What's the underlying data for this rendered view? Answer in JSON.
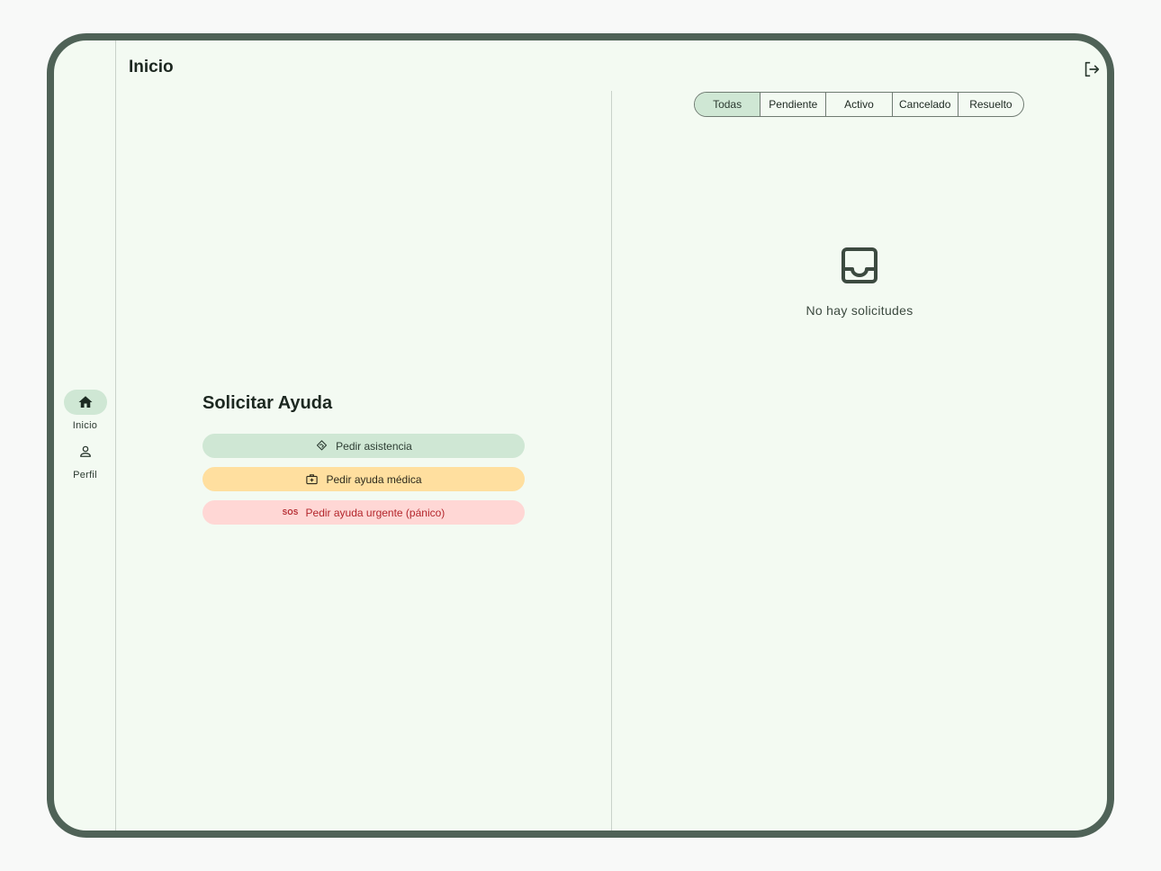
{
  "header": {
    "title": "Inicio"
  },
  "nav": {
    "items": [
      {
        "label": "Inicio",
        "icon": "home-icon",
        "active": true
      },
      {
        "label": "Perfil",
        "icon": "person-icon",
        "active": false
      }
    ]
  },
  "request_panel": {
    "heading": "Solicitar Ayuda",
    "buttons": {
      "assist": {
        "label": "Pedir asistencia",
        "icon": "handshake-icon"
      },
      "medical": {
        "label": "Pedir ayuda médica",
        "icon": "medical-kit-icon"
      },
      "panic": {
        "label": "Pedir ayuda urgente (pánico)",
        "icon_text": "SOS"
      }
    }
  },
  "filters": {
    "options": [
      "Todas",
      "Pendiente",
      "Activo",
      "Cancelado",
      "Resuelto"
    ],
    "selected": "Todas"
  },
  "empty_state": {
    "message": "No hay solicitudes",
    "icon": "inbox-icon"
  },
  "colors": {
    "frame": "#4f6257",
    "background": "#f3faf2",
    "assist": "#cfe7d4",
    "medical": "#ffdf9f",
    "panic": "#ffd7d5",
    "panic_text": "#b3262c"
  }
}
